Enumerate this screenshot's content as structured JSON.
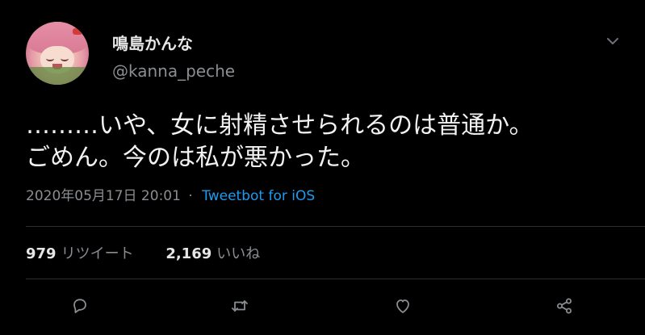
{
  "user": {
    "display_name": "鳴島かんな",
    "handle": "@kanna_peche"
  },
  "tweet": {
    "lines": [
      "………いや、女に射精させられるのは普通か。",
      "ごめん。今のは私が悪かった。"
    ],
    "timestamp": "2020年05月17日 20:01",
    "separator": "·",
    "source": "Tweetbot for iOS"
  },
  "stats": {
    "retweets_count": "979",
    "retweets_label": "リツイート",
    "likes_count": "2,169",
    "likes_label": "いいね"
  },
  "icons": {
    "more": "chevron-down-icon",
    "reply": "reply-icon",
    "retweet": "retweet-icon",
    "like": "heart-icon",
    "share": "share-icon"
  },
  "colors": {
    "background": "#000000",
    "text": "#f2f2f2",
    "secondary": "#8a8d91",
    "accent": "#1d9bf0",
    "divider": "#2a2d31"
  }
}
